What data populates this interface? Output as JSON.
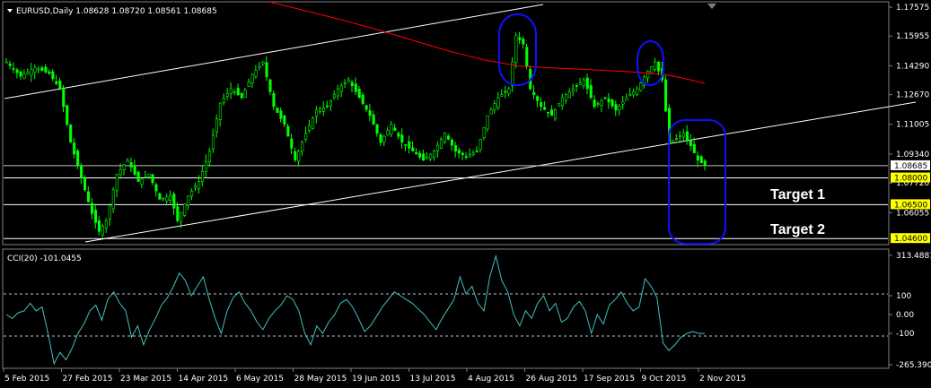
{
  "chart_data": {
    "type": "candlestick",
    "header": "EURUSD,Daily  1.08628 1.08720 1.08561 1.08685",
    "symbol": "EURUSD",
    "timeframe": "Daily",
    "ohlc_last": {
      "open": 1.08628,
      "high": 1.0872,
      "low": 1.08561,
      "close": 1.08685
    },
    "ylim": [
      1.0446,
      1.17575
    ],
    "y_tick_labels": [
      "1.17575",
      "1.15955",
      "1.14290",
      "1.12670",
      "1.11005",
      "1.09340",
      "1.07720",
      "1.06055"
    ],
    "highlighted_prices": [
      "1.08685",
      "1.08000",
      "1.06500",
      "1.04600"
    ],
    "x_tick_labels": [
      "5 Feb 2015",
      "27 Feb 2015",
      "23 Mar 2015",
      "14 Apr 2015",
      "6 May 2015",
      "28 May 2015",
      "19 Jun 2015",
      "13 Jul 2015",
      "4 Aug 2015",
      "26 Aug 2015",
      "17 Sep 2015",
      "9 Oct 2015",
      "2 Nov 2015"
    ],
    "close_path": [
      [
        0,
        1.145
      ],
      [
        4,
        1.137
      ],
      [
        8,
        1.142
      ],
      [
        12,
        1.1385
      ],
      [
        15,
        1.13
      ],
      [
        18,
        1.1
      ],
      [
        21,
        1.08
      ],
      [
        24,
        1.06
      ],
      [
        26,
        1.05
      ],
      [
        28,
        1.056
      ],
      [
        31,
        1.082
      ],
      [
        34,
        1.09
      ],
      [
        37,
        1.078
      ],
      [
        40,
        1.082
      ],
      [
        43,
        1.068
      ],
      [
        46,
        1.07
      ],
      [
        48,
        1.056
      ],
      [
        51,
        1.07
      ],
      [
        54,
        1.078
      ],
      [
        57,
        1.095
      ],
      [
        60,
        1.122
      ],
      [
        63,
        1.13
      ],
      [
        66,
        1.125
      ],
      [
        69,
        1.138
      ],
      [
        72,
        1.145
      ],
      [
        75,
        1.12
      ],
      [
        78,
        1.11
      ],
      [
        81,
        1.09
      ],
      [
        84,
        1.105
      ],
      [
        87,
        1.118
      ],
      [
        90,
        1.12
      ],
      [
        93,
        1.13
      ],
      [
        96,
        1.135
      ],
      [
        99,
        1.125
      ],
      [
        102,
        1.115
      ],
      [
        105,
        1.1
      ],
      [
        108,
        1.11
      ],
      [
        111,
        1.1
      ],
      [
        114,
        1.095
      ],
      [
        117,
        1.09
      ],
      [
        120,
        1.095
      ],
      [
        123,
        1.105
      ],
      [
        126,
        1.095
      ],
      [
        129,
        1.092
      ],
      [
        132,
        1.095
      ],
      [
        135,
        1.115
      ],
      [
        138,
        1.125
      ],
      [
        141,
        1.13
      ],
      [
        143,
        1.16
      ],
      [
        145,
        1.155
      ],
      [
        147,
        1.13
      ],
      [
        150,
        1.12
      ],
      [
        153,
        1.115
      ],
      [
        156,
        1.125
      ],
      [
        159,
        1.13
      ],
      [
        162,
        1.135
      ],
      [
        165,
        1.12
      ],
      [
        168,
        1.125
      ],
      [
        171,
        1.118
      ],
      [
        174,
        1.125
      ],
      [
        177,
        1.13
      ],
      [
        180,
        1.14
      ],
      [
        182,
        1.145
      ],
      [
        184,
        1.135
      ],
      [
        186,
        1.1
      ],
      [
        188,
        1.102
      ],
      [
        190,
        1.105
      ],
      [
        192,
        1.098
      ],
      [
        194,
        1.09
      ],
      [
        196,
        1.0868
      ]
    ],
    "candle_color": "#00ff00",
    "moving_average": {
      "color": "#ff0000"
    },
    "channel_lines": {
      "color": "#ffffff"
    },
    "horizontal_levels": [
      {
        "price": 1.08685,
        "label": "1.08685",
        "color": "#c0c0c0"
      },
      {
        "price": 1.08,
        "label": "1.08000",
        "color": "#ffffff"
      },
      {
        "price": 1.065,
        "label": "1.06500",
        "color": "#ffffff"
      },
      {
        "price": 1.046,
        "label": "1.04600",
        "color": "#ffffff"
      }
    ],
    "annotations": [
      {
        "text": "Target 1",
        "price": 1.072
      },
      {
        "text": "Target 2",
        "price": 1.054
      }
    ],
    "highlight_ovals": {
      "count": 3,
      "color": "#0000ff"
    },
    "indicator": {
      "type": "line",
      "label": "CCI(20) -101.0455",
      "name": "CCI(20)",
      "value": -101.0455,
      "color": "#40c0c0",
      "ylim": [
        -265.3903,
        313.4881
      ],
      "y_tick_labels": [
        "313.4881",
        "100",
        "0.00",
        "-100",
        "-265.3903"
      ],
      "levels": [
        100,
        -100
      ],
      "values": [
        0,
        -20,
        10,
        20,
        60,
        20,
        40,
        -100,
        -260,
        -200,
        -240,
        -180,
        -100,
        -50,
        20,
        50,
        -30,
        80,
        120,
        60,
        20,
        -120,
        -60,
        -160,
        -80,
        -20,
        50,
        90,
        150,
        220,
        180,
        100,
        150,
        200,
        80,
        -20,
        -100,
        20,
        90,
        120,
        60,
        20,
        -40,
        -80,
        -20,
        20,
        50,
        100,
        80,
        20,
        -100,
        -160,
        -60,
        -100,
        -40,
        0,
        60,
        80,
        40,
        -20,
        -90,
        -60,
        -10,
        40,
        80,
        120,
        100,
        80,
        60,
        30,
        0,
        -40,
        -80,
        -20,
        30,
        80,
        200,
        110,
        150,
        60,
        20,
        200,
        310,
        180,
        120,
        0,
        -60,
        20,
        -20,
        60,
        100,
        20,
        60,
        -40,
        -20,
        40,
        70,
        20,
        -100,
        0,
        -50,
        50,
        80,
        120,
        60,
        20,
        40,
        190,
        150,
        90,
        -150,
        -190,
        -160,
        -120,
        -100,
        -90,
        -100,
        -100
      ]
    }
  }
}
